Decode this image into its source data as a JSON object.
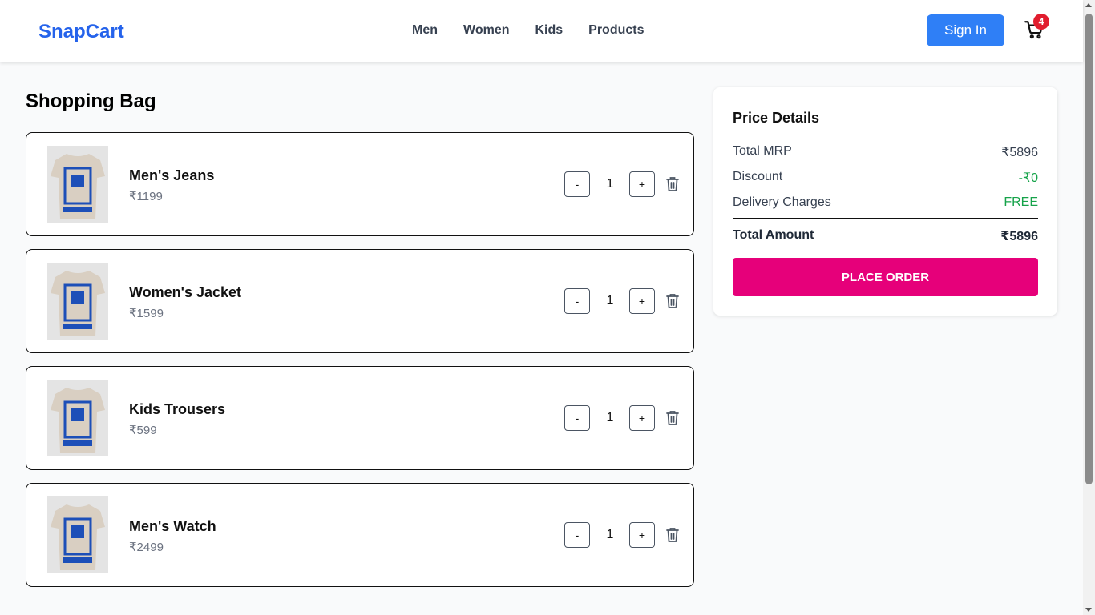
{
  "header": {
    "brand": "SnapCart",
    "nav": [
      "Men",
      "Women",
      "Kids",
      "Products"
    ],
    "sign_in": "Sign In",
    "cart_count": "4"
  },
  "main": {
    "title": "Shopping Bag",
    "items": [
      {
        "name": "Men's Jeans",
        "price": "₹1199",
        "qty": "1",
        "minus": "-",
        "plus": "+"
      },
      {
        "name": "Women's Jacket",
        "price": "₹1599",
        "qty": "1",
        "minus": "-",
        "plus": "+"
      },
      {
        "name": "Kids Trousers",
        "price": "₹599",
        "qty": "1",
        "minus": "-",
        "plus": "+"
      },
      {
        "name": "Men's Watch",
        "price": "₹2499",
        "qty": "1",
        "minus": "-",
        "plus": "+"
      }
    ]
  },
  "price_details": {
    "title": "Price Details",
    "total_mrp_label": "Total MRP",
    "total_mrp": "₹5896",
    "discount_label": "Discount",
    "discount": "-₹0",
    "delivery_label": "Delivery Charges",
    "delivery": "FREE",
    "total_label": "Total Amount",
    "total": "₹5896",
    "place_order": "PLACE ORDER"
  },
  "colors": {
    "brand": "#2563eb",
    "sign_in": "#2f7ff6",
    "place_order": "#e6007a",
    "badge": "#e11d2e",
    "green": "#16a34a"
  }
}
